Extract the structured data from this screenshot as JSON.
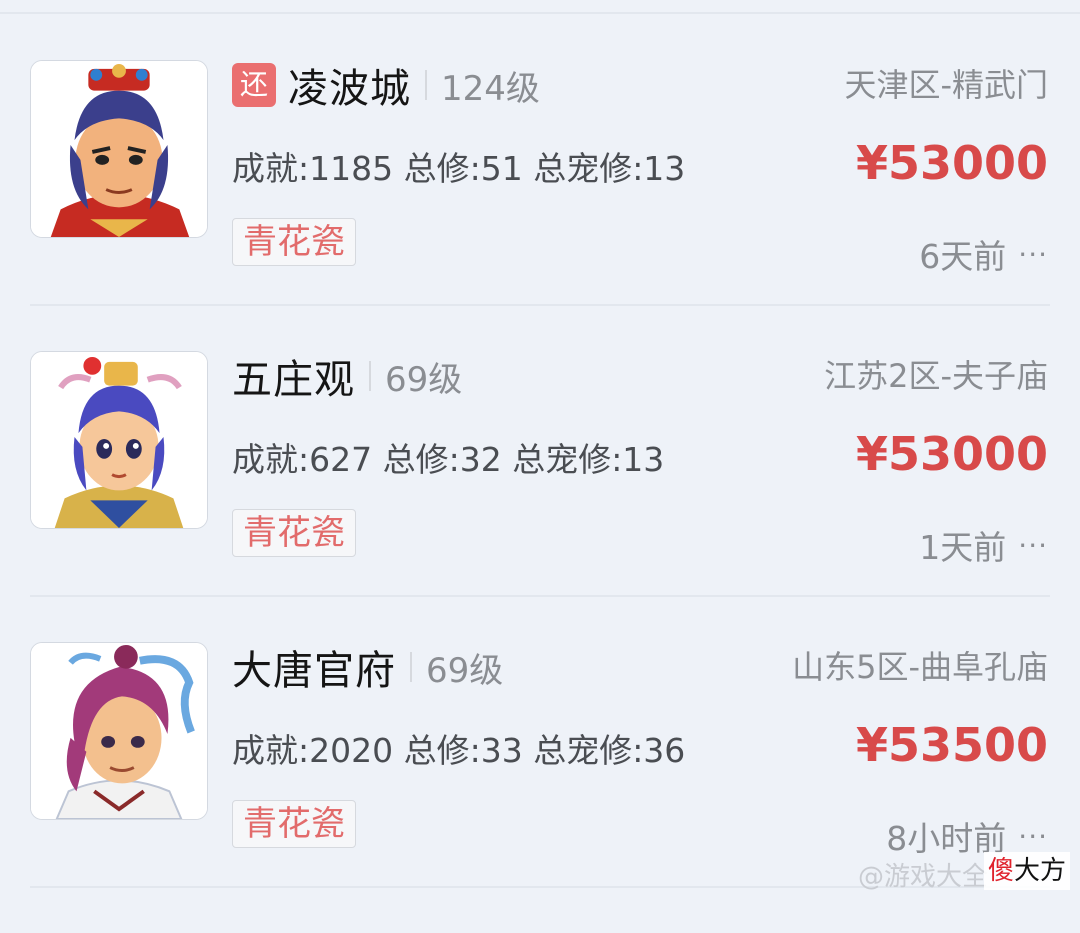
{
  "listings": [
    {
      "badge": "还",
      "school": "凌波城",
      "level": "124级",
      "server": "天津区-精武门",
      "stats": "成就:1185 总修:51 总宠修:13",
      "price": "¥53000",
      "tag": "青花瓷",
      "time": "6天前",
      "more": "···"
    },
    {
      "school": "五庄观",
      "level": "69级",
      "server": "江苏2区-夫子庙",
      "stats": "成就:627 总修:32 总宠修:13",
      "price": "¥53000",
      "tag": "青花瓷",
      "time": "1天前",
      "more": "···"
    },
    {
      "school": "大唐官府",
      "level": "69级",
      "server": "山东5区-曲阜孔庙",
      "stats": "成就:2020 总修:33 总宠修:36",
      "price": "¥53500",
      "tag": "青花瓷",
      "time": "8小时前",
      "more": "···"
    }
  ],
  "watermark": {
    "text": "@游戏大全",
    "logo_red": "傻",
    "logo_black": "大方"
  },
  "colors": {
    "price": "#d84a4a",
    "tag_text": "#e26b6b",
    "badge_bg": "#ea6f70",
    "background": "#eef2f8"
  }
}
